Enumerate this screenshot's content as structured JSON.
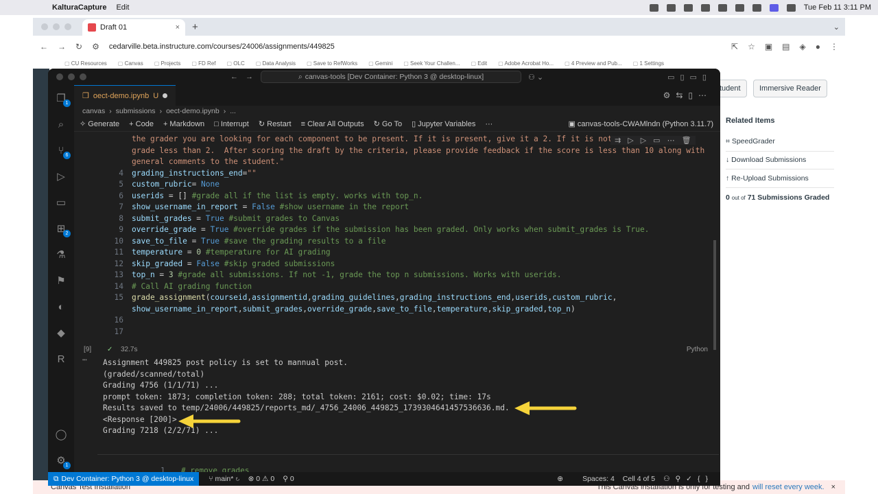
{
  "menubar": {
    "app": "KalturaCapture",
    "edit": "Edit",
    "datetime": "Tue Feb 11  3:11 PM"
  },
  "browser": {
    "tab_title": "Draft 01",
    "url": "cedarville.beta.instructure.com/courses/24006/assignments/449825",
    "bookmarks": [
      "CU Resources",
      "Canvas",
      "Projects",
      "FD Ref",
      "OLC",
      "Data Analysis",
      "Save to RefWorks",
      "Gemini",
      "Seek Your Challen...",
      "Edit",
      "Adobe Acrobat Ho...",
      "4 Preview and Pub...",
      "1 Settings"
    ]
  },
  "canvas": {
    "student_btn": "tudent",
    "immersive_reader": "Immersive Reader",
    "related_title": "Related Items",
    "related": [
      "SpeedGrader",
      "Download Submissions",
      "Re-Upload Submissions"
    ],
    "graded_count": "0",
    "graded_of": "out of",
    "graded_total": "71 Submissions Graded",
    "footer_left": "Canvas Test Installation",
    "footer_right": "This Canvas installation is only for testing and",
    "footer_link": "will reset every week."
  },
  "vscode": {
    "search": "canvas-tools [Dev Container: Python 3 @ desktop-linux]",
    "tab": "oect-demo.ipynb",
    "tab_flag": "U",
    "breadcrumbs": [
      "canvas",
      "submissions",
      "oect-demo.ipynb",
      "..."
    ],
    "toolbar": {
      "generate": "Generate",
      "code": "+ Code",
      "markdown": "+ Markdown",
      "interrupt": "Interrupt",
      "restart": "Restart",
      "clear": "Clear All Outputs",
      "goto": "Go To",
      "variables": "Jupyter Variables",
      "more": "···",
      "kernel": "canvas-tools-CWAMlndn (Python 3.11.7)"
    },
    "cell_exec": "[9]",
    "cell_time": "32.7s",
    "cell_lang": "Python",
    "output": [
      "Assignment 449825 post policy is set to mannual post.",
      "(graded/scanned/total)",
      "Grading 4756 (1/1/71) ...",
      "prompt token: 1873; completion token: 288; total token: 2161; cost: $0.02; time: 17s",
      "Results saved to temp/24006/449825/reports_md/_4756_24006_449825_1739304641457536636.md.",
      "<Response [200]>",
      "Grading 7218 (2/2/71) ..."
    ],
    "next_cell_line": "1",
    "next_cell_code": "# remove grades",
    "status": {
      "remote": "Dev Container: Python 3 @ desktop-linux",
      "branch": "main*",
      "errors": "0",
      "warnings": "0",
      "ports": "0",
      "spaces": "Spaces: 4",
      "cell": "Cell 4 of 5"
    }
  },
  "colors": {
    "accent": "#0078d4",
    "arrow": "#f5d33a",
    "canvas_nav": "#2d3b45"
  }
}
